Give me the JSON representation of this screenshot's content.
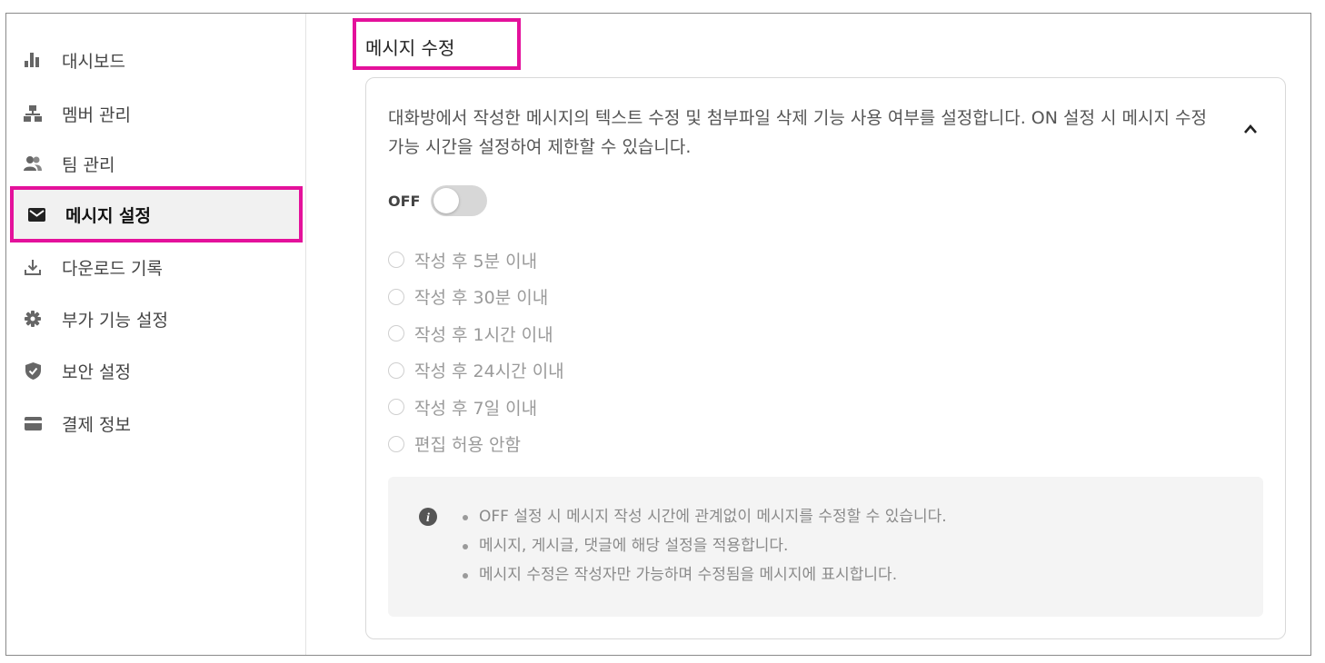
{
  "sidebar": {
    "items": [
      {
        "label": "대시보드",
        "icon": "bar-chart-icon"
      },
      {
        "label": "멤버 관리",
        "icon": "org-chart-icon"
      },
      {
        "label": "팀 관리",
        "icon": "users-icon"
      },
      {
        "label": "메시지 설정",
        "icon": "mail-icon",
        "active": true
      },
      {
        "label": "다운로드 기록",
        "icon": "download-icon"
      },
      {
        "label": "부가 기능 설정",
        "icon": "gear-icon"
      },
      {
        "label": "보안 설정",
        "icon": "shield-check-icon"
      },
      {
        "label": "결제 정보",
        "icon": "credit-card-icon"
      }
    ]
  },
  "section": {
    "title": "메시지 수정",
    "description": "대화방에서 작성한 메시지의 텍스트 수정 및 첨부파일 삭제 기능 사용 여부를 설정합니다. ON 설정 시 메시지 수정 가능 시간을 설정하여 제한할 수 있습니다.",
    "toggle_label": "OFF",
    "toggle_on": false,
    "options": [
      "작성 후 5분 이내",
      "작성 후 30분 이내",
      "작성 후 1시간 이내",
      "작성 후 24시간 이내",
      "작성 후 7일 이내",
      "편집 허용 안함"
    ],
    "info": [
      "OFF 설정 시 메시지 작성 시간에 관계없이 메시지를 수정할 수 있습니다.",
      "메시지, 게시글, 댓글에 해당 설정을 적용합니다.",
      "메시지 수정은 작성자만 가능하며 수정됨을 메시지에 표시합니다."
    ]
  },
  "colors": {
    "highlight": "#e4119b",
    "active_bg": "#f1f1f1",
    "toggle_off": "#d7d7d7"
  }
}
